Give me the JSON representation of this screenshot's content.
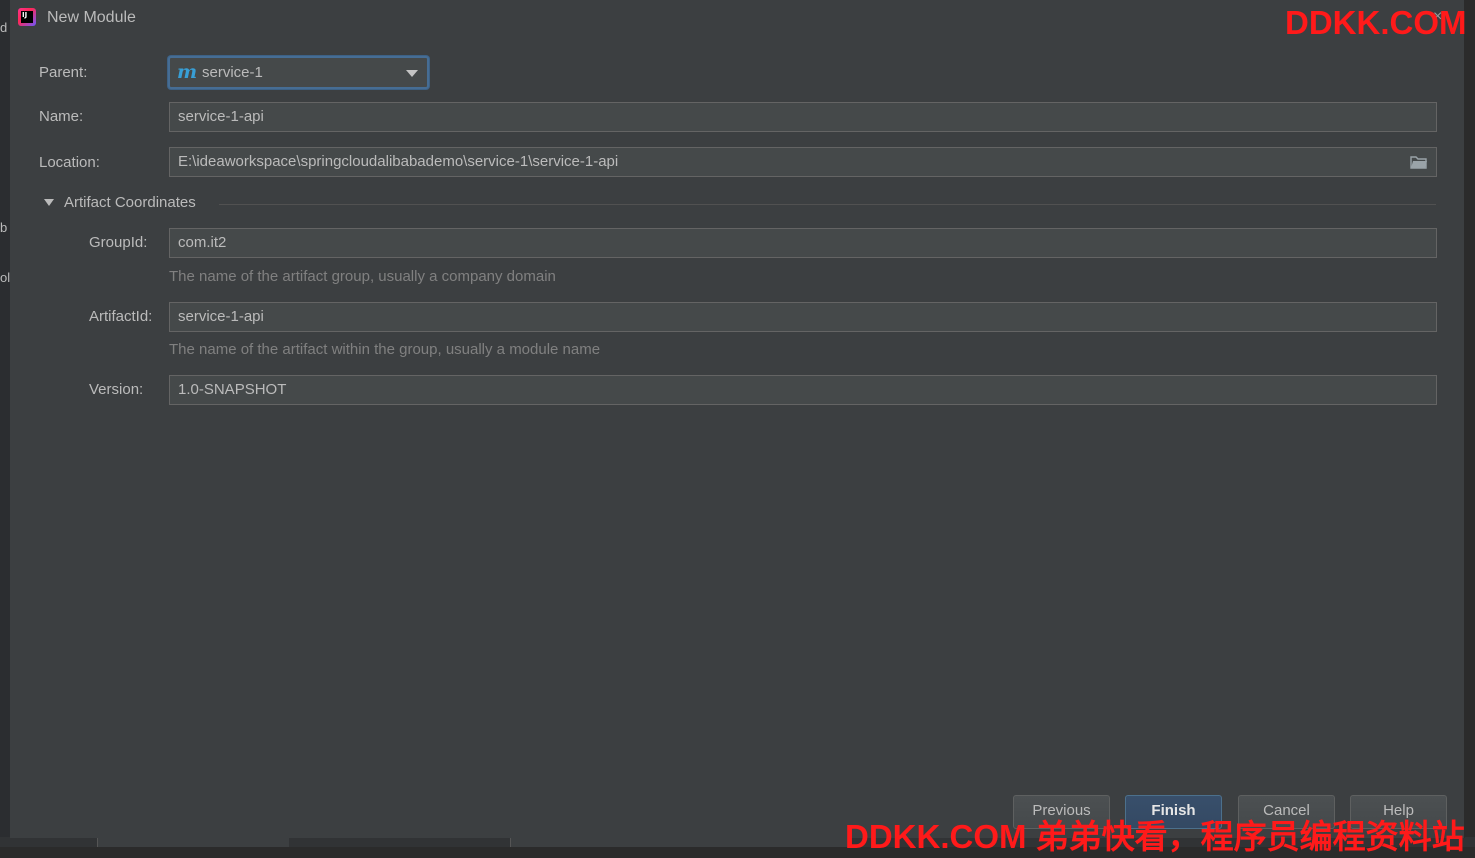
{
  "background_window": {
    "edge_letters": [
      "d",
      "b",
      "ol"
    ]
  },
  "dialog": {
    "title": "New Module",
    "close_glyph": "×"
  },
  "form": {
    "parent": {
      "label": "Parent:",
      "value": "service-1",
      "icon": "maven-m-icon",
      "icon_glyph": "m"
    },
    "name": {
      "label": "Name:",
      "value": "service-1-api"
    },
    "location": {
      "label": "Location:",
      "value": "E:\\ideaworkspace\\springcloudalibabademo\\service-1\\service-1-api",
      "icon": "folder-icon"
    }
  },
  "artifact_coordinates": {
    "title": "Artifact Coordinates",
    "expanded": true,
    "group_id": {
      "label": "GroupId:",
      "value": "com.it2",
      "hint": "The name of the artifact group, usually a company domain"
    },
    "artifact_id": {
      "label": "ArtifactId:",
      "value": "service-1-api",
      "hint": "The name of the artifact within the group, usually a module name"
    },
    "version": {
      "label": "Version:",
      "value": "1.0-SNAPSHOT"
    }
  },
  "buttons": {
    "previous": "Previous",
    "finish": "Finish",
    "cancel": "Cancel",
    "help": "Help"
  },
  "watermarks": {
    "top": "DDKK.COM",
    "bottom": "DDKK.COM 弟弟快看，程序员编程资料站"
  },
  "colors": {
    "dialog_bg": "#3c3f41",
    "field_bg": "#45494a",
    "focus_border": "#466d94",
    "primary_button": "#365880",
    "watermark": "#ff1a1a",
    "maven_icon": "#389fd6"
  }
}
